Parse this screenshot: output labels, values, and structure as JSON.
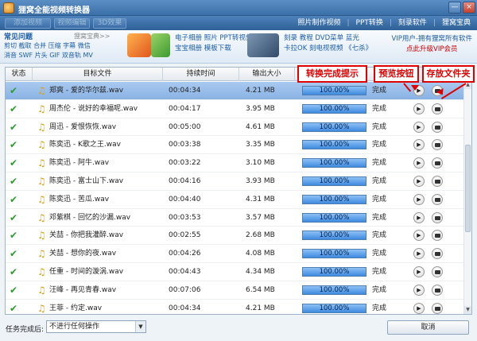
{
  "window": {
    "title": "狸窝全能视频转换器",
    "minimize": "—",
    "close": "×"
  },
  "toolbar": {
    "left_buttons": [
      "添加视频",
      "视频编辑",
      "3D效果"
    ],
    "nav": [
      "照片制作视频",
      "PPT转换",
      "刻录软件",
      "狸窝宝典"
    ]
  },
  "banner": {
    "faq_title": "常见问题",
    "faq_more": "狸窝宝典>>",
    "faq_row1": "剪切 截取 合并 压缩 字幕 微信",
    "faq_row2": "消音 SWF 片头 GIF 双音轨 MV",
    "ad1_line1": "电子相册 照片 PPT转视频",
    "ad1_line2": "宝宝相册 模板下载",
    "ad2_line1": "刻录 教程 DVD菜单 蓝光",
    "ad2_line2": "卡拉OK 刻电视视频 《七杀》",
    "vip_line1": "VIP用户-拥有狸窝所有软件",
    "vip_line2": "点此升级VIP会员"
  },
  "table": {
    "headers": [
      "状态",
      "目标文件",
      "持续时间",
      "输出大小"
    ],
    "rows": [
      {
        "file": "郑爽 - 爱的华尔兹.wav",
        "duration": "00:04:34",
        "size": "4.21 MB",
        "progress": "100.00%",
        "status": "完成"
      },
      {
        "file": "周杰伦 - 说好的幸福呢.wav",
        "duration": "00:04:17",
        "size": "3.95 MB",
        "progress": "100.00%",
        "status": "完成"
      },
      {
        "file": "周迅 - 爱恨恢恢.wav",
        "duration": "00:05:00",
        "size": "4.61 MB",
        "progress": "100.00%",
        "status": "完成"
      },
      {
        "file": "陈奕迅 - K歌之王.wav",
        "duration": "00:03:38",
        "size": "3.35 MB",
        "progress": "100.00%",
        "status": "完成"
      },
      {
        "file": "陈奕迅 - 阿牛.wav",
        "duration": "00:03:22",
        "size": "3.10 MB",
        "progress": "100.00%",
        "status": "完成"
      },
      {
        "file": "陈奕迅 - 富士山下.wav",
        "duration": "00:04:16",
        "size": "3.93 MB",
        "progress": "100.00%",
        "status": "完成"
      },
      {
        "file": "陈奕迅 - 苦瓜.wav",
        "duration": "00:04:40",
        "size": "4.31 MB",
        "progress": "100.00%",
        "status": "完成"
      },
      {
        "file": "邓紫棋 - 回忆的沙漏.wav",
        "duration": "00:03:53",
        "size": "3.57 MB",
        "progress": "100.00%",
        "status": "完成"
      },
      {
        "file": "关喆 - 你把我灌醉.wav",
        "duration": "00:02:55",
        "size": "2.68 MB",
        "progress": "100.00%",
        "status": "完成"
      },
      {
        "file": "关喆 - 想你的夜.wav",
        "duration": "00:04:26",
        "size": "4.08 MB",
        "progress": "100.00%",
        "status": "完成"
      },
      {
        "file": "任重 - 时间的漩涡.wav",
        "duration": "00:04:43",
        "size": "4.34 MB",
        "progress": "100.00%",
        "status": "完成"
      },
      {
        "file": "汪峰 - 再见青春.wav",
        "duration": "00:07:06",
        "size": "6.54 MB",
        "progress": "100.00%",
        "status": "完成"
      },
      {
        "file": "王菲 - 约定.wav",
        "duration": "00:04:34",
        "size": "4.21 MB",
        "progress": "100.00%",
        "status": "完成"
      }
    ]
  },
  "annotations": {
    "complete_tip": "转换完成提示",
    "preview_btn": "预览按钮",
    "folder_btn": "存放文件夹"
  },
  "footer": {
    "label": "任务完成后:",
    "select_value": "不进行任何操作",
    "cancel": "取消"
  },
  "colors": {
    "titlebar": "#3b6fa8",
    "progress": "#3f8ae0",
    "annotation": "#e00000",
    "selected_row": "#a9c9ef"
  }
}
